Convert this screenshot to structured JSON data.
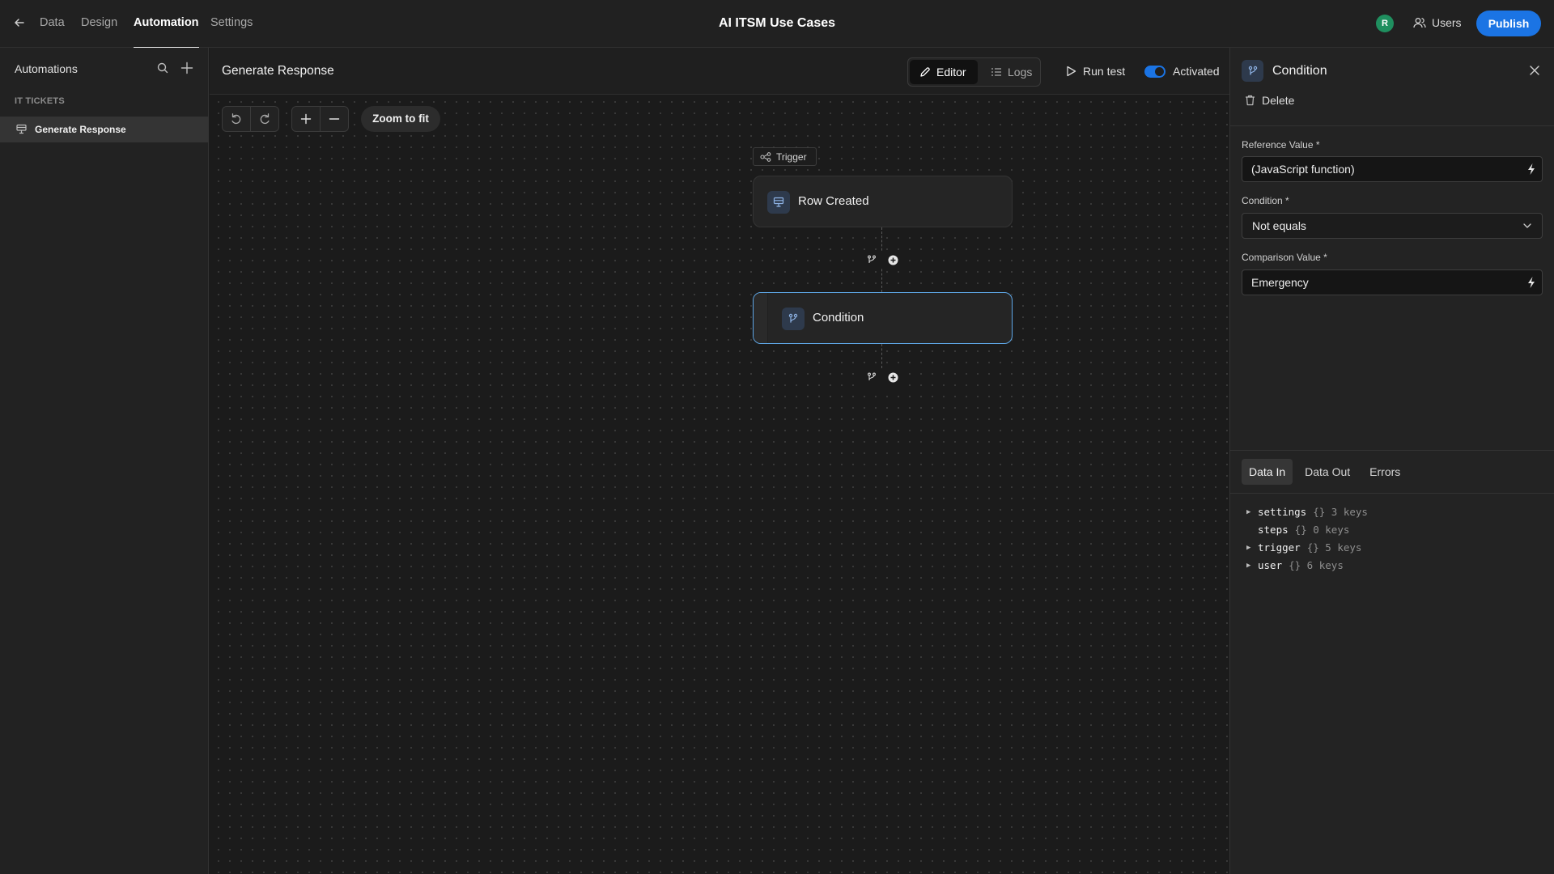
{
  "topbar": {
    "nav": [
      "Data",
      "Design",
      "Automation",
      "Settings"
    ],
    "active_nav": "Automation",
    "app_title": "AI ITSM Use Cases",
    "avatar_initial": "R",
    "avatar_color": "#1f8f5f",
    "users_label": "Users",
    "publish_label": "Publish",
    "accent_color": "#1b74e4"
  },
  "sidebar": {
    "title": "Automations",
    "section": "IT TICKETS",
    "items": [
      {
        "label": "Generate Response",
        "selected": true
      }
    ]
  },
  "main": {
    "title": "Generate Response",
    "editor_label": "Editor",
    "logs_label": "Logs",
    "run_test_label": "Run test",
    "activated_label": "Activated",
    "activated": true,
    "zoom_fit_label": "Zoom to fit",
    "trigger_tag": "Trigger",
    "nodes": [
      {
        "label": "Row Created",
        "icon": "table-icon"
      },
      {
        "label": "Condition",
        "icon": "branch-icon",
        "selected": true
      }
    ]
  },
  "panel": {
    "title": "Condition",
    "delete_label": "Delete",
    "reference_label": "Reference Value *",
    "reference_value": "(JavaScript function)",
    "condition_label": "Condition *",
    "condition_value": "Not equals",
    "comparison_label": "Comparison Value *",
    "comparison_value": "Emergency",
    "tabs": [
      "Data In",
      "Data Out",
      "Errors"
    ],
    "active_tab": "Data In",
    "tree": [
      {
        "key": "settings",
        "meta": "{} 3 keys",
        "expandable": true
      },
      {
        "key": "steps",
        "meta": "{} 0 keys",
        "expandable": false
      },
      {
        "key": "trigger",
        "meta": "{} 5 keys",
        "expandable": true
      },
      {
        "key": "user",
        "meta": "{} 6 keys",
        "expandable": true
      }
    ]
  }
}
